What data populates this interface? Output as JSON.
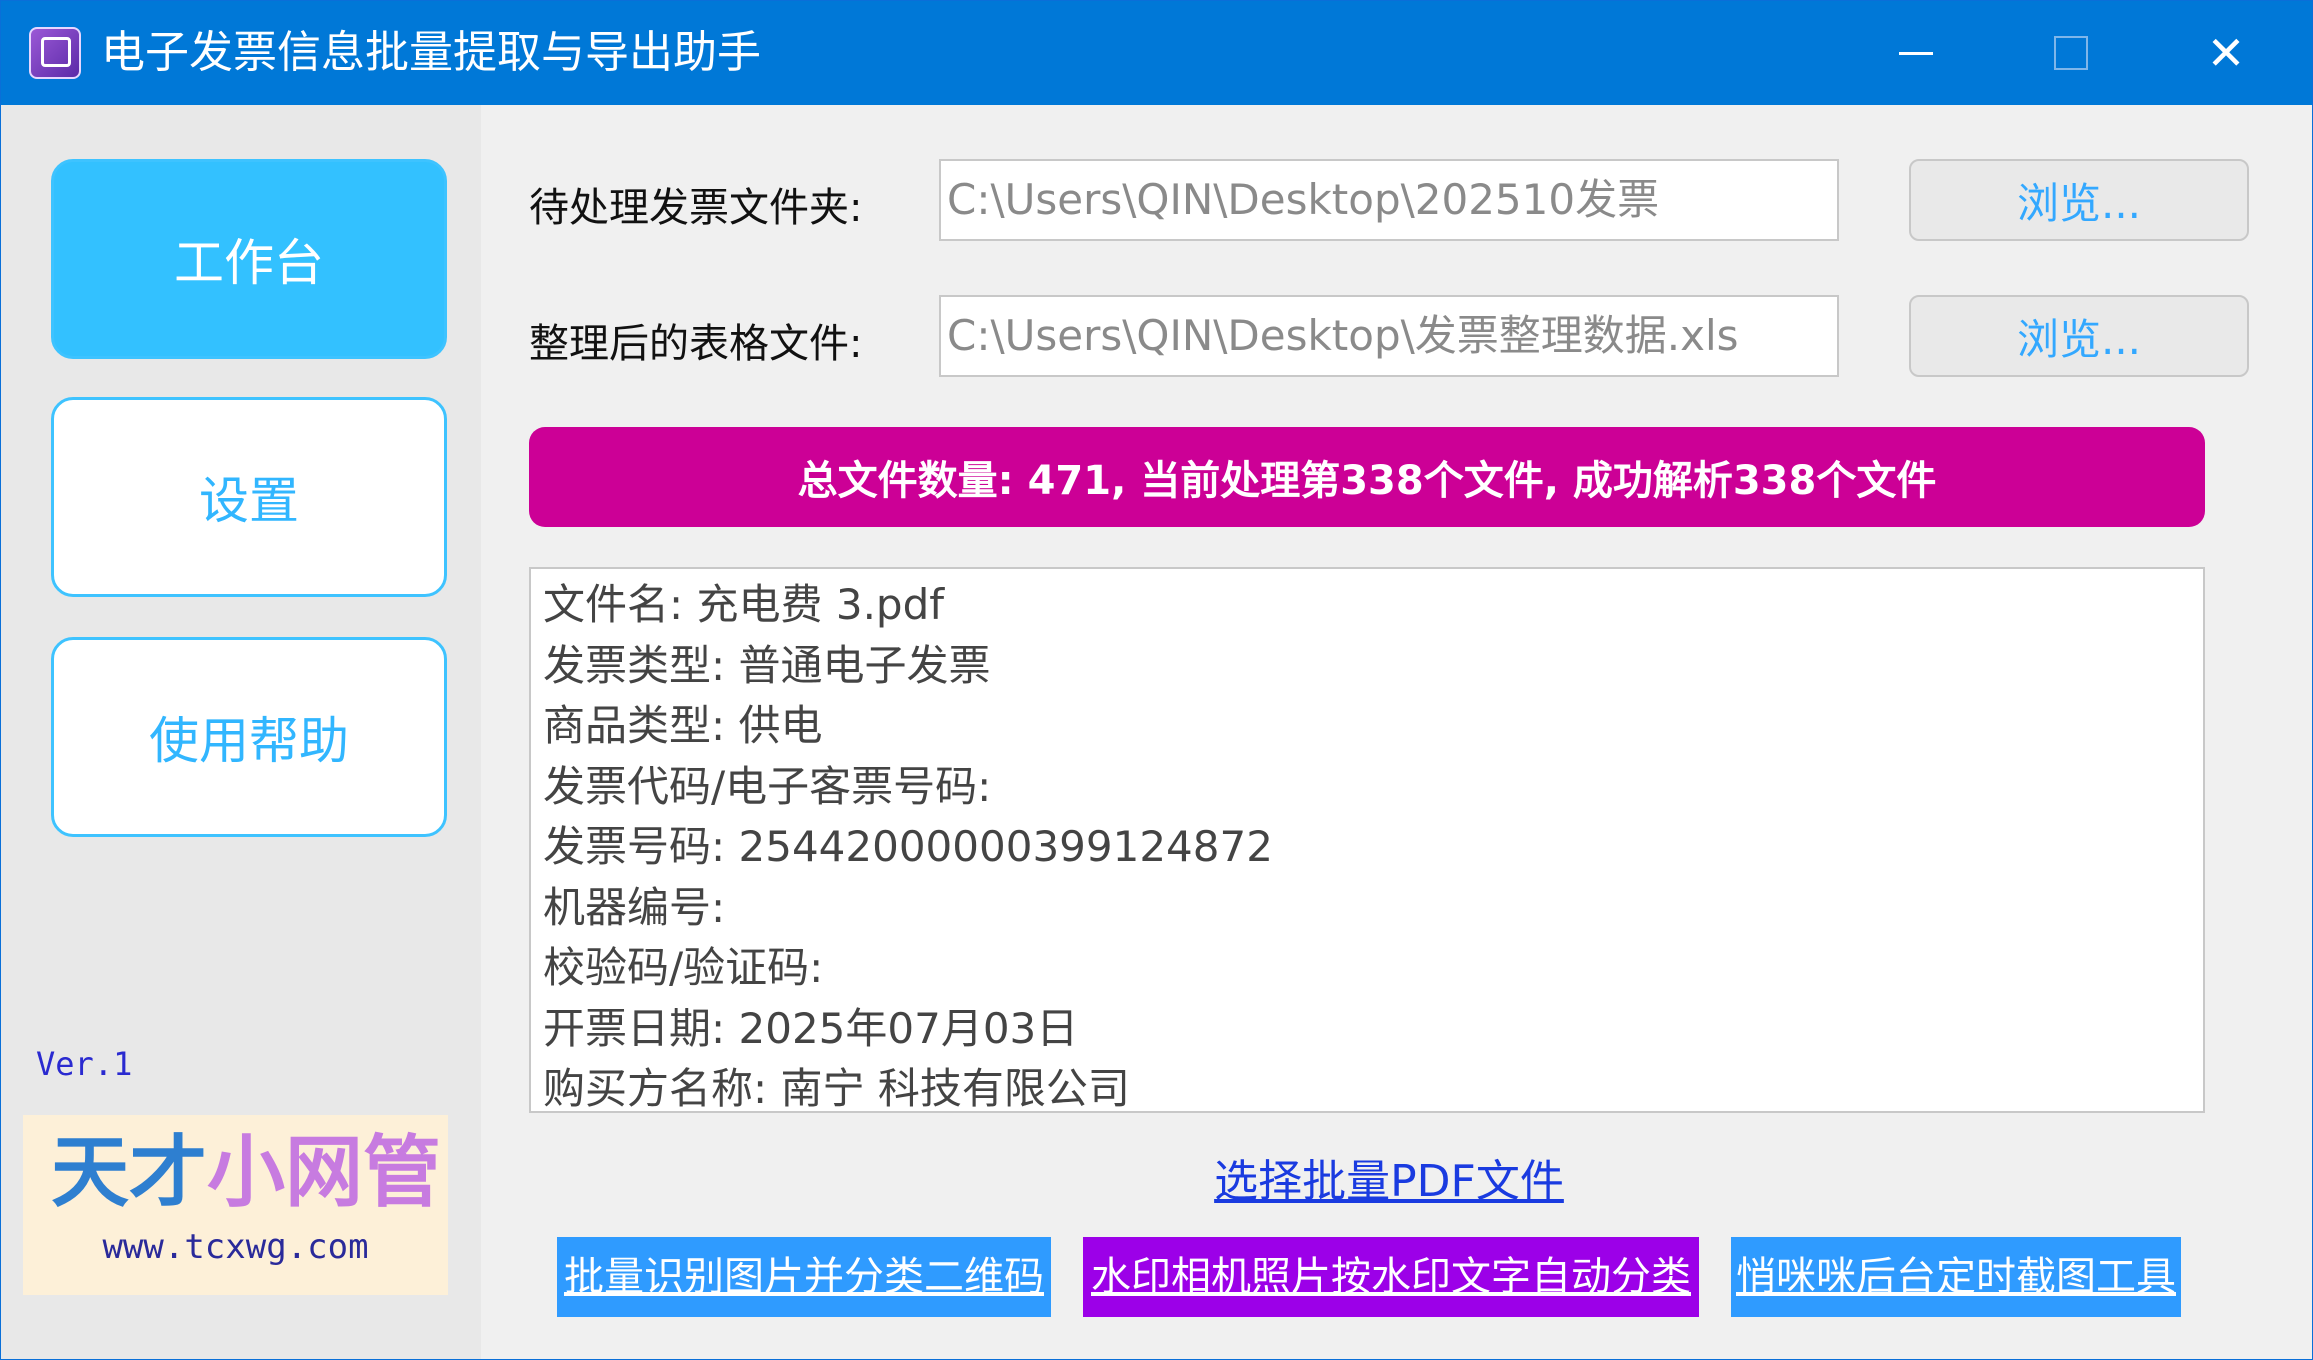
{
  "window": {
    "title": "电子发票信息批量提取与导出助手",
    "controls": {
      "minimize": "—",
      "maximize": "□",
      "close": "✕"
    }
  },
  "sidebar": {
    "items": [
      {
        "label": "工作台",
        "active": true
      },
      {
        "label": "设置",
        "active": false
      },
      {
        "label": "使用帮助",
        "active": false
      }
    ],
    "version": "Ver.1",
    "brand": {
      "name_part1": "天才",
      "name_part2": "小网管",
      "url": "www.tcxwg.com"
    }
  },
  "form": {
    "input_folder": {
      "label": "待处理发票文件夹:",
      "value": "C:\\Users\\QIN\\Desktop\\202510发票",
      "browse_label": "浏览..."
    },
    "output_file": {
      "label": "整理后的表格文件:",
      "value": "C:\\Users\\QIN\\Desktop\\发票整理数据.xls",
      "browse_label": "浏览..."
    }
  },
  "status": {
    "text": "总文件数量: 471, 当前处理第338个文件, 成功解析338个文件"
  },
  "log": {
    "lines": [
      "文件名: 充电费 3.pdf",
      "发票类型: 普通电子发票",
      "商品类型: 供电",
      "发票代码/电子客票号码:",
      "发票号码: 25442000000399124872",
      "机器编号:",
      "校验码/验证码:",
      "开票日期: 2025年07月03日",
      "购买方名称: 南宁              科技有限公司"
    ]
  },
  "actions": {
    "select_pdf": "选择批量PDF文件",
    "tools": [
      "批量识别图片并分类二维码",
      "水印相机照片按水印文字自动分类",
      "悄咪咪后台定时截图工具"
    ]
  },
  "colors": {
    "titlebar": "#0078d7",
    "nav_active": "#33c1ff",
    "status_bar": "#cc0096",
    "tool_blue": "#2f9bff",
    "tool_purple": "#9c00e8"
  },
  "icons": {
    "app": "app-icon",
    "minimize": "minimize-icon",
    "maximize": "maximize-icon",
    "close": "close-icon"
  }
}
